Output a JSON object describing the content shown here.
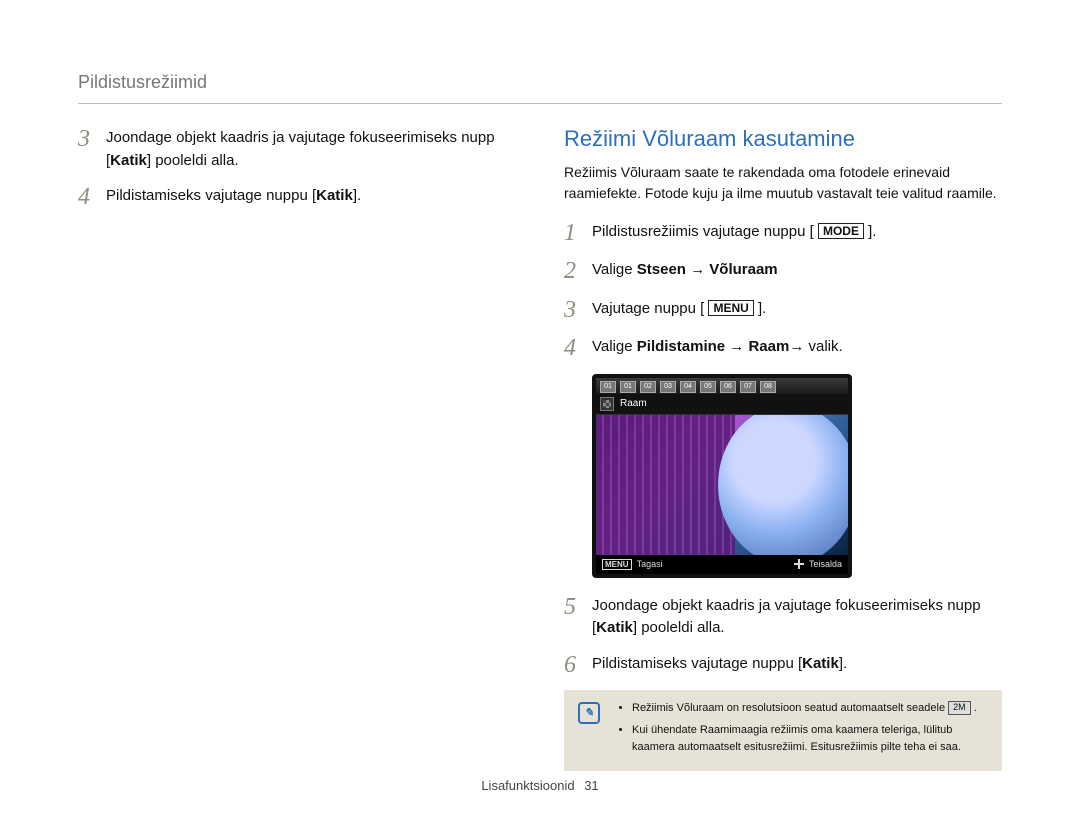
{
  "header": {
    "title": "Pildistusrežiimid"
  },
  "left": {
    "steps": [
      {
        "num": "3",
        "parts": [
          "Joondage objekt kaadris ja vajutage fokuseerimiseks nupp [",
          "Katik",
          "] pooleldi alla."
        ]
      },
      {
        "num": "4",
        "parts": [
          "Pildistamiseks vajutage nuppu [",
          "Katik",
          "]."
        ]
      }
    ]
  },
  "right": {
    "section_title": "Režiimi Võluraam kasutamine",
    "intro": "Režiimis Võluraam saate te rakendada oma fotodele erinevaid raamiefekte. Fotode kuju ja ilme muutub vastavalt teie valitud raamile.",
    "steps": [
      {
        "num": "1",
        "parts": [
          "Pildistusrežiimis vajutage nuppu [ ",
          "MODE",
          " ]."
        ],
        "has_box": true
      },
      {
        "num": "2",
        "parts": [
          "Valige ",
          "Stseen → Võluraam"
        ],
        "bold2": true
      },
      {
        "num": "3",
        "parts": [
          "Vajutage nuppu [ ",
          "MENU",
          " ]."
        ],
        "has_box": true
      },
      {
        "num": "4",
        "parts": [
          "Valige ",
          "Pildistamine → Raam",
          "→ valik."
        ],
        "bold2": true
      },
      {
        "num": "5",
        "parts": [
          "Joondage objekt kaadris ja vajutage fokuseerimiseks nupp [",
          "Katik",
          "] pooleldi alla."
        ]
      },
      {
        "num": "6",
        "parts": [
          "Pildistamiseks vajutage nuppu [",
          "Katik",
          "]."
        ]
      }
    ],
    "screenshot": {
      "top_tabs": [
        "01",
        "01",
        "02",
        "03",
        "04",
        "05",
        "06",
        "07",
        "08"
      ],
      "frame_label": "Raam",
      "bottom_menu_label": "MENU",
      "bottom_back": "Tagasi",
      "bottom_move": "Teisalda"
    },
    "note": {
      "items": [
        [
          "Režiimis Võluraam on resolutsioon seatud automaatselt seadele ",
          "2M",
          " ."
        ],
        [
          "Kui ühendate Raamimaagia režiimis oma kaamera teleriga, lülitub kaamera automaatselt esitusrežiimi. Esitusrežiimis pilte teha ei saa."
        ]
      ]
    }
  },
  "footer": {
    "section": "Lisafunktsioonid",
    "page": "31"
  }
}
